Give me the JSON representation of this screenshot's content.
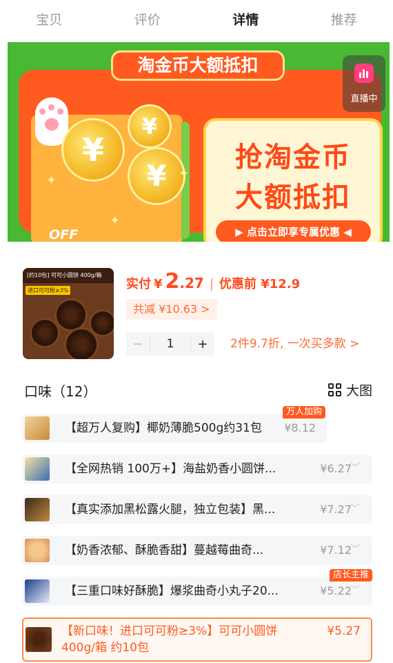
{
  "tabs": [
    {
      "label": "宝贝"
    },
    {
      "label": "评价"
    },
    {
      "label": "详情"
    },
    {
      "label": "推荐"
    }
  ],
  "banner": {
    "top_title": "淘金币大额抵扣",
    "slogan_line1": "抢淘金币",
    "slogan_line2": "大额抵扣",
    "cta": "▶ 点击立即享专属优惠 ◀",
    "off_tag": "OFF",
    "coin_symbol": "¥",
    "live_label": "直播中"
  },
  "product": {
    "thumb_header": "[约10包] 可可小圆饼  400g/箱",
    "thumb_tag": "进口可可粉≥3%",
    "actual_label": "实付",
    "currency": "¥",
    "price_int": "2",
    "price_dec": ".27",
    "separator": "|",
    "original_price": "优惠前 ¥12.9",
    "saving": "共减 ¥10.63 >",
    "quantity": "1",
    "minus": "−",
    "plus": "+",
    "promo": "2件9.7折, 一次买多款  >"
  },
  "flavors_section": {
    "title": "口味（12）",
    "big_view": "大图"
  },
  "flavors": [
    {
      "name": "【超万人复购】椰奶薄脆500g约31包",
      "price": "¥8.12",
      "badge": "万人加购"
    },
    {
      "name": "【全网热销 100万+】海盐奶香小圆饼...",
      "price": "¥6.27",
      "badge": ""
    },
    {
      "name": "【真实添加黑松露火腿，独立包装】黑...",
      "price": "¥7.27",
      "badge": ""
    },
    {
      "name": "【奶香浓郁、酥脆香甜】蔓越莓曲奇...",
      "price": "¥7.12",
      "badge": ""
    },
    {
      "name": "【三重口味好酥脆】爆浆曲奇小丸子20...",
      "price": "¥5.22",
      "badge": "店长主推"
    },
    {
      "name": "【新口味！进口可可粉≥3%】可可小圆饼 400g/箱 约10包",
      "price": "¥5.27",
      "badge": ""
    }
  ],
  "colors": {
    "accent": "#ff5a1f",
    "banner_green": "#49b833",
    "muted": "#9a9a9a"
  }
}
